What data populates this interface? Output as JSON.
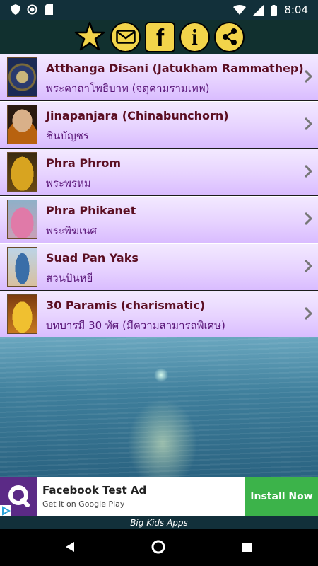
{
  "status_bar": {
    "time": "8:04"
  },
  "toolbar": {
    "buttons": [
      {
        "icon": "star-icon"
      },
      {
        "icon": "mail-icon"
      },
      {
        "icon": "facebook-icon",
        "label": "f"
      },
      {
        "icon": "info-icon",
        "label": "i"
      },
      {
        "icon": "share-icon"
      }
    ],
    "accent_color": "#f2d44a"
  },
  "list": {
    "items": [
      {
        "title": "Atthanga Disani (Jatukham Rammathep)",
        "subtitle": "พระคาถาโพธิบาท (จตุคามรามเทพ)"
      },
      {
        "title": "Jinapanjara (Chinabunchorn)",
        "subtitle": "ชินบัญชร"
      },
      {
        "title": "Phra Phrom",
        "subtitle": "พระพรหม"
      },
      {
        "title": "Phra Phikanet",
        "subtitle": "พระพิฆเนศ"
      },
      {
        "title": "Suad Pan Yaks",
        "subtitle": "สวนปันหยี"
      },
      {
        "title": "30 Paramis (charismatic)",
        "subtitle": "บทบารมี 30 ทัศ (มีความสามารถพิเศษ)"
      }
    ]
  },
  "ad": {
    "title": "Facebook Test Ad",
    "subtitle": "Get it on Google Play",
    "install_label": "Install Now",
    "install_color": "#3cb34a"
  },
  "footer": {
    "text": "Big Kids Apps"
  }
}
